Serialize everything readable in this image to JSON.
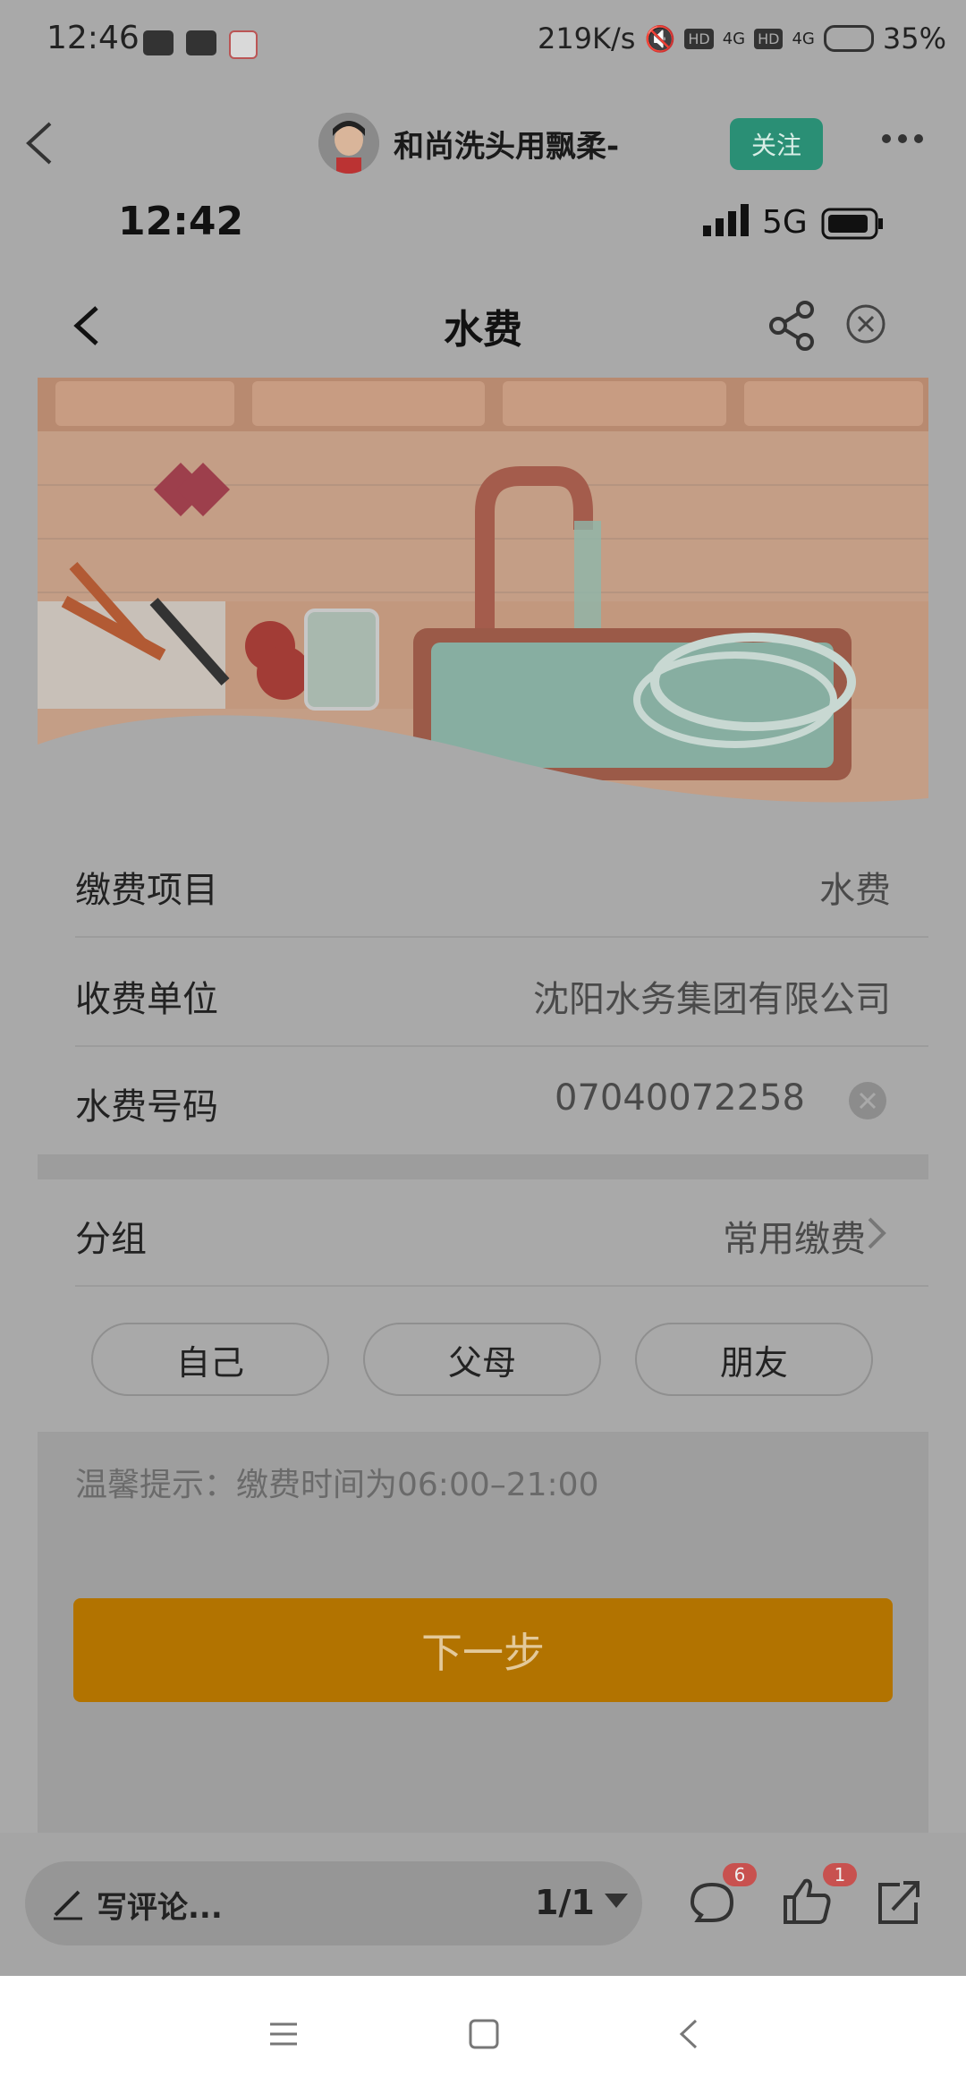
{
  "status_bar": {
    "time": "12:46",
    "speed": "219K/s",
    "battery": "35%",
    "hd_label": "HD",
    "network_label": "4G"
  },
  "post_header": {
    "author": "和尚洗头用飘柔-",
    "follow_label": "关注"
  },
  "inner_phone": {
    "time": "12:42",
    "network": "5G"
  },
  "inner_page": {
    "title": "水费"
  },
  "form": {
    "rows": [
      {
        "label": "缴费项目",
        "value": "水费"
      },
      {
        "label": "收费单位",
        "value": "沈阳水务集团有限公司"
      },
      {
        "label": "水费号码",
        "value": "07040072258"
      }
    ],
    "group_label": "分组",
    "group_value": "常用缴费",
    "tags": [
      "自己",
      "父母",
      "朋友"
    ]
  },
  "tip": "温馨提示：缴费时间为06:00–21:00",
  "next_button": "下一步",
  "bottom_bar": {
    "comment_placeholder": "写评论...",
    "page_indicator": "1/1",
    "comment_count": "6",
    "like_count": "1"
  },
  "colors": {
    "follow_bg": "#2a8f75",
    "next_bg": "#b27300",
    "badge": "#c8514f"
  }
}
